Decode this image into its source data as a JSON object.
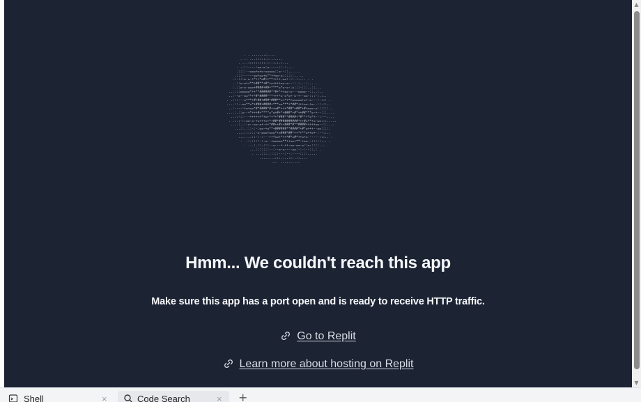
{
  "error": {
    "heading": "Hmm... We couldn't reach this app",
    "message": "Make sure this app has a port open and is ready to receive HTTP traffic.",
    "links": [
      {
        "label": "Go to Replit",
        "icon": "link-icon"
      },
      {
        "label": "Learn more about hosting on Replit",
        "icon": "link-icon"
      }
    ]
  },
  "tabs": [
    {
      "label": "Shell",
      "icon": "shell-icon"
    },
    {
      "label": "Code Search",
      "icon": "search-icon"
    }
  ],
  "tab_close_symbol": "×",
  "add_tab_symbol": "+",
  "colors": {
    "background": "#1c2333",
    "text": "#f5f7fa",
    "link": "#d8dde6"
  }
}
